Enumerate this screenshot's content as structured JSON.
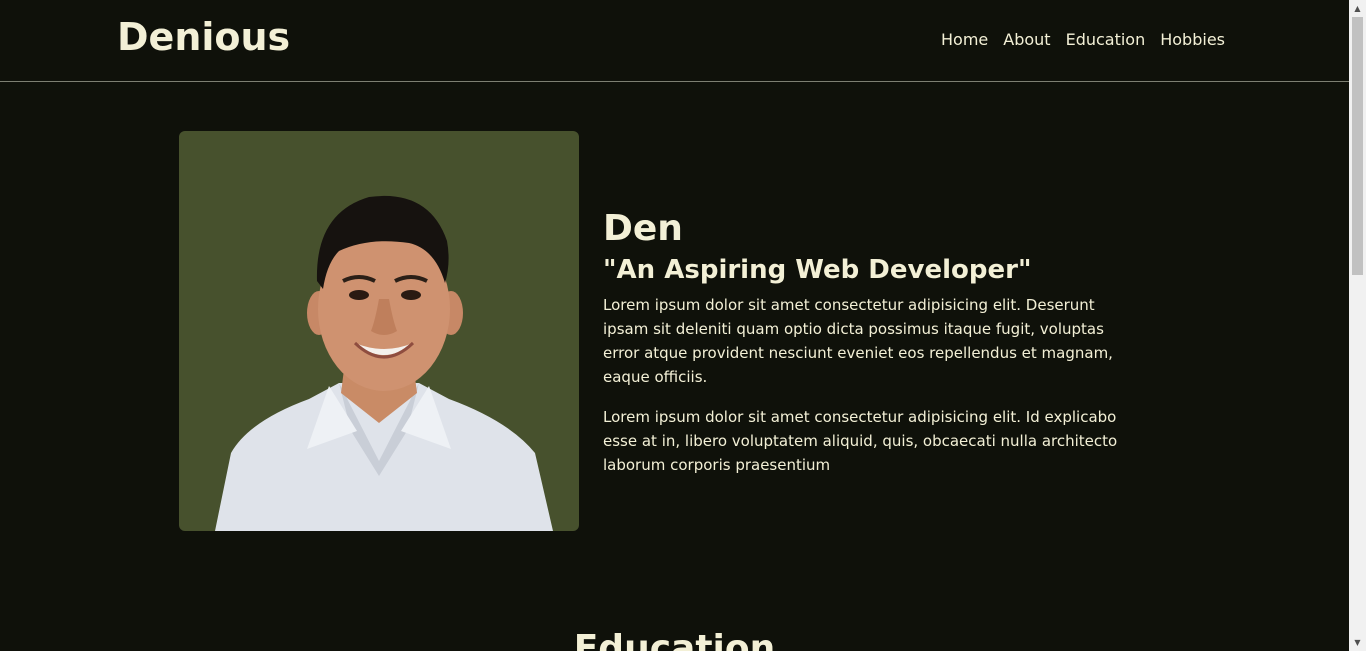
{
  "brand": "Denious",
  "nav": {
    "items": [
      {
        "label": "Home"
      },
      {
        "label": "About"
      },
      {
        "label": "Education"
      },
      {
        "label": "Hobbies"
      }
    ]
  },
  "hero": {
    "name": "Den",
    "tagline": "\"An Aspiring Web Developer\"",
    "paragraph1": "Lorem ipsum dolor sit amet consectetur adipisicing elit. Deserunt ipsam sit deleniti quam optio dicta possimus itaque fugit, voluptas error atque provident nesciunt eveniet eos repellendus et magnam, eaque officiis.",
    "paragraph2": "Lorem ipsum dolor sit amet consectetur adipisicing elit. Id explicabo esse at in, libero voluptatem aliquid, quis, obcaecati nulla architecto laborum corporis praesentium"
  },
  "sections": {
    "education_title": "Education"
  },
  "colors": {
    "background": "#0f110a",
    "photo_background": "#47512d",
    "text": "#f3f0d6"
  }
}
